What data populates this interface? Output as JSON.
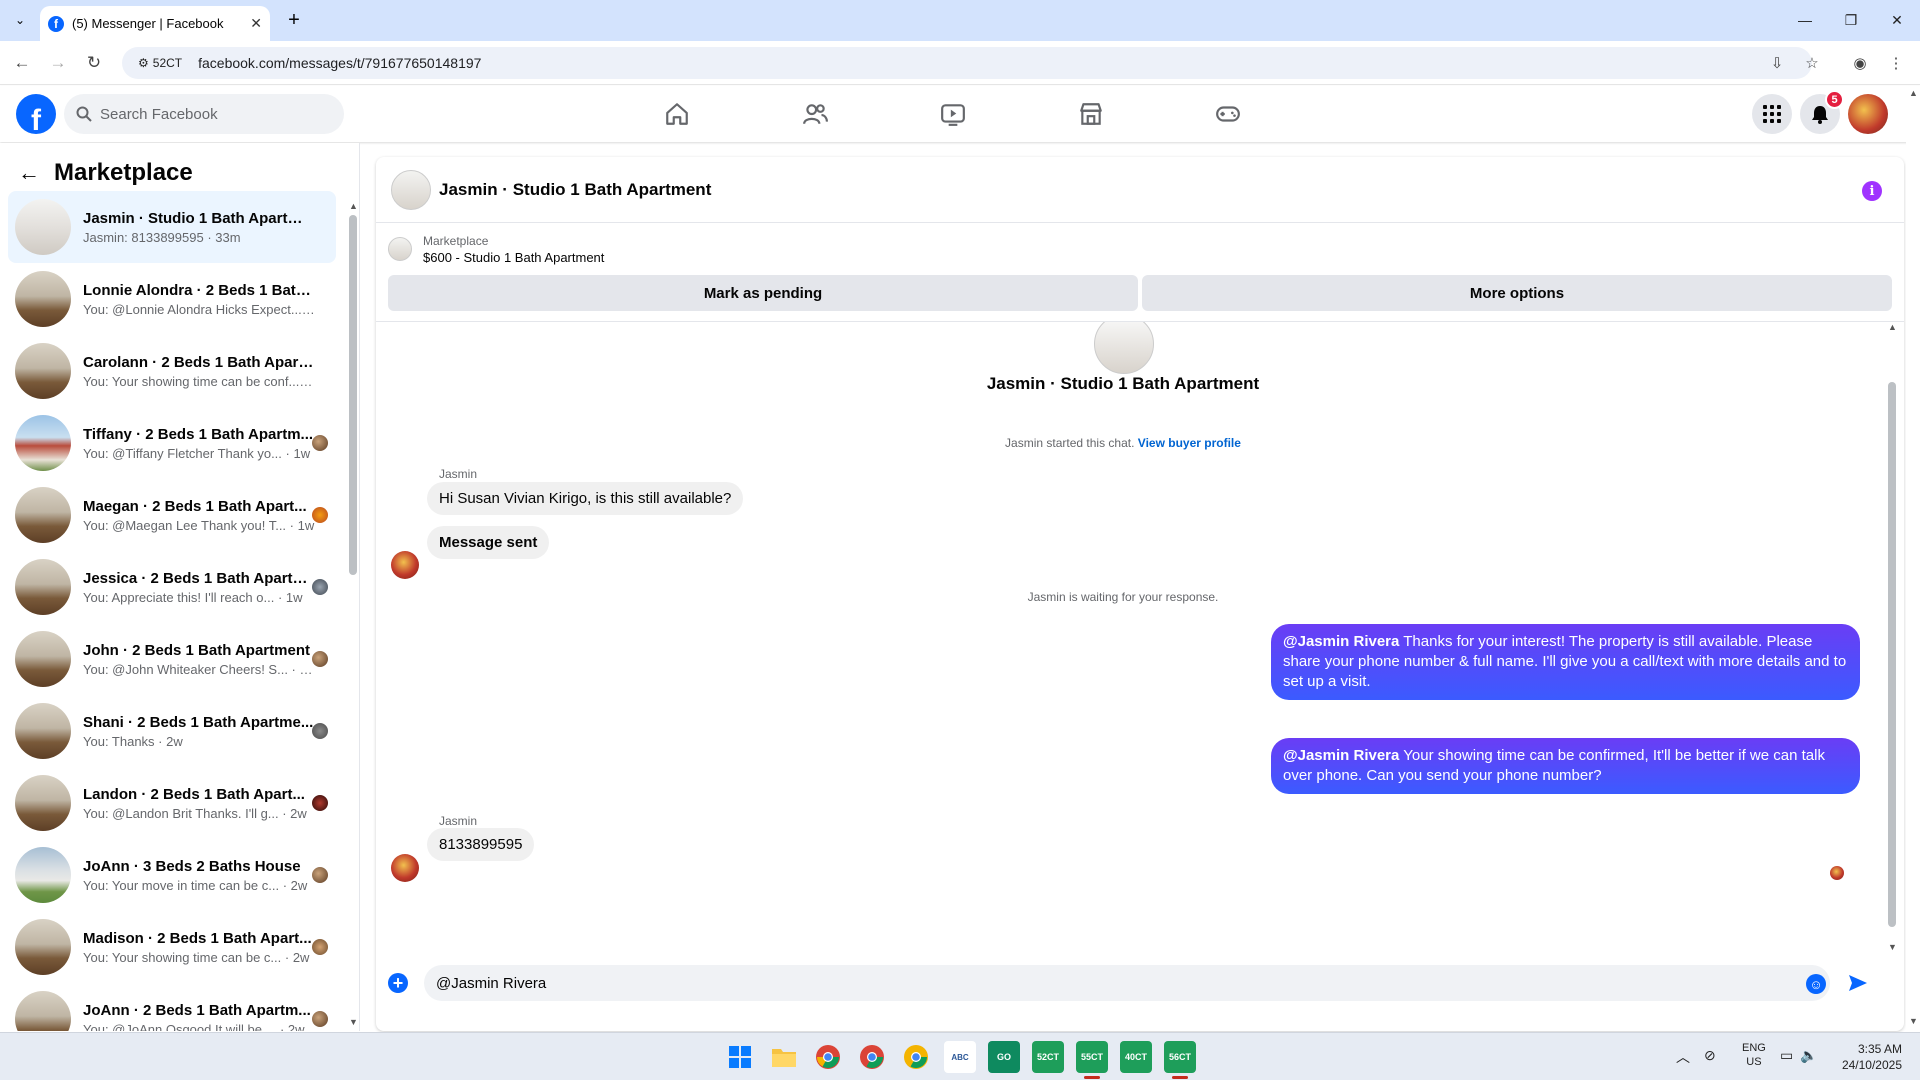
{
  "browser": {
    "tab_title": "(5) Messenger | Facebook",
    "site_chip": "52CT",
    "url": "facebook.com/messages/t/791677650148197"
  },
  "fb": {
    "search_placeholder": "Search Facebook",
    "notification_count": "5",
    "brand_color": "#0866ff"
  },
  "sidebar": {
    "title": "Marketplace",
    "conversations": [
      {
        "name": "Jasmin · Studio 1 Bath Apartment",
        "preview": "Jasmin: 8133899595 · 33m",
        "active": true
      },
      {
        "name": "Lonnie Alondra · 2 Beds 1 Bath A...",
        "preview": "You: @Lonnie Alondra Hicks Expect... · 1d"
      },
      {
        "name": "Carolann · 2 Beds 1 Bath Apartm...",
        "preview": "You: Your showing time can be conf... · 5d"
      },
      {
        "name": "Tiffany · 2 Beds 1 Bath Apartm...",
        "preview": "You: @Tiffany Fletcher Thank yo... · 1w"
      },
      {
        "name": "Maegan · 2 Beds 1 Bath Apart...",
        "preview": "You: @Maegan Lee Thank you! T... · 1w"
      },
      {
        "name": "Jessica · 2 Beds 1 Bath Apartm...",
        "preview": "You: Appreciate this! I'll reach o... · 1w"
      },
      {
        "name": "John · 2 Beds 1 Bath Apartment",
        "preview": "You: @John Whiteaker Cheers! S... · 1w"
      },
      {
        "name": "Shani · 2 Beds 1 Bath Apartme...",
        "preview": "You: Thanks · 2w"
      },
      {
        "name": "Landon · 2 Beds 1 Bath Apart...",
        "preview": "You: @Landon Brit Thanks. I'll g... · 2w"
      },
      {
        "name": "JoAnn · 3 Beds 2 Baths House",
        "preview": "You: Your move in time can be c... · 2w"
      },
      {
        "name": "Madison · 2 Beds 1 Bath Apart...",
        "preview": "You: Your showing time can be c... · 2w"
      },
      {
        "name": "JoAnn · 2 Beds 1 Bath Apartm...",
        "preview": "You: @JoAnn Osgood It will be ... · 2w"
      }
    ]
  },
  "chat": {
    "title": "Jasmin · Studio 1 Bath Apartment",
    "listing_source": "Marketplace",
    "listing_title": "$600 - Studio 1 Bath Apartment",
    "mark_pending": "Mark as pending",
    "more_options": "More options",
    "started_text": "Jasmin started this chat.",
    "view_buyer_profile": "View buyer profile",
    "sender_name": "Jasmin",
    "msg_in_1": "Hi Susan Vivian Kirigo, is this still available?",
    "msg_in_2": "Message sent",
    "waiting_text": "Jasmin is waiting for your response.",
    "msg_out_1_mention": "@Jasmin Rivera",
    "msg_out_1_text": " Thanks for your interest! The property is still available. Please share your phone number & full name. I'll give you a call/text with more details and to set up a visit.",
    "msg_out_2_mention": "@Jasmin Rivera",
    "msg_out_2_text": " Your showing time can be confirmed, It'll be better if we can talk over phone. Can you send your phone number?",
    "msg_in_3": "8133899595",
    "composer_value": "@Jasmin Rivera",
    "outgoing_color": "#5851ff"
  },
  "taskbar": {
    "lang_1": "ENG",
    "lang_2": "US",
    "time": "3:35 AM",
    "date": "24/10/2025",
    "app_labels": [
      "52CT",
      "55CT",
      "40CT",
      "56CT"
    ]
  }
}
